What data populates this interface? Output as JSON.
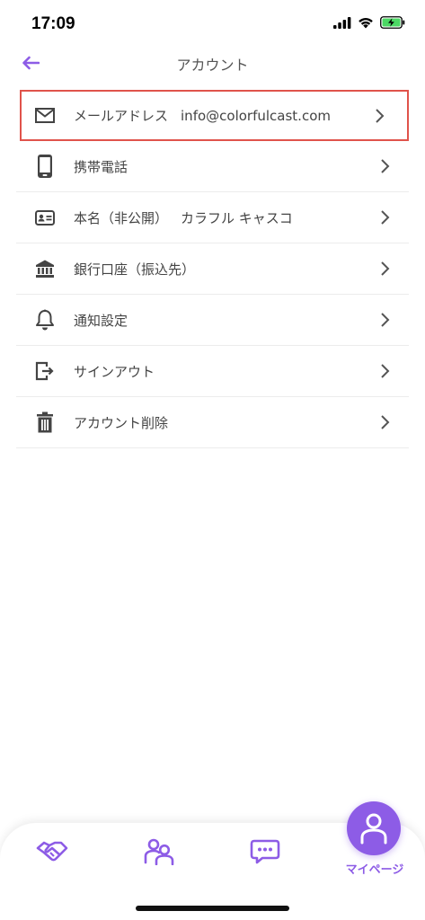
{
  "status_bar": {
    "time": "17:09",
    "icons": [
      "signal-icon",
      "wifi-icon",
      "battery-charging-icon"
    ]
  },
  "header": {
    "title": "アカウント",
    "back_icon": "arrow-left-icon"
  },
  "menu": [
    {
      "icon": "mail-icon",
      "label": "メールアドレス",
      "value": "info@colorfulcast.com",
      "highlighted": true
    },
    {
      "icon": "smartphone-icon",
      "label": "携帯電話",
      "value": ""
    },
    {
      "icon": "id-card-icon",
      "label": "本名（非公開）",
      "value": "カラフル キャスコ"
    },
    {
      "icon": "bank-icon",
      "label": "銀行口座（振込先）",
      "value": ""
    },
    {
      "icon": "bell-icon",
      "label": "通知設定",
      "value": ""
    },
    {
      "icon": "sign-out-icon",
      "label": "サインアウト",
      "value": ""
    },
    {
      "icon": "trash-icon",
      "label": "アカウント削除",
      "value": ""
    }
  ],
  "tab_bar": {
    "tabs": [
      {
        "icon": "handshake-icon"
      },
      {
        "icon": "people-icon"
      },
      {
        "icon": "chat-icon"
      }
    ],
    "active": {
      "icon": "person-icon",
      "label": "マイページ"
    }
  },
  "colors": {
    "accent": "#8d5ce6",
    "highlight_border": "#e0534b",
    "icon_gray": "#444444",
    "battery_green": "#4cd964"
  }
}
